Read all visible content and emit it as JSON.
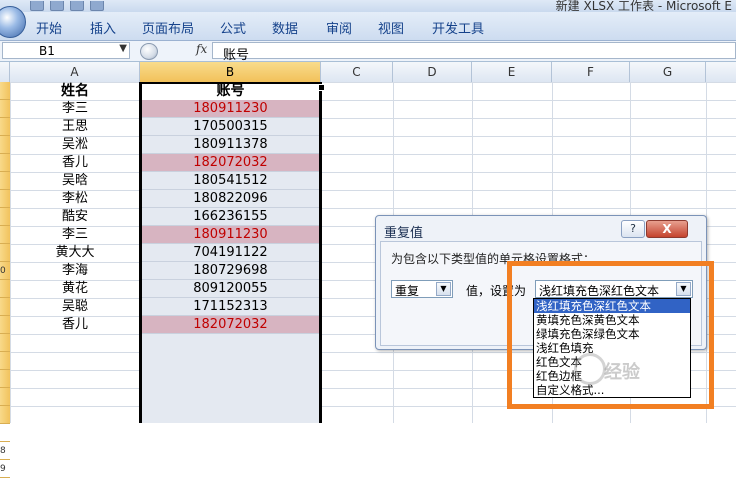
{
  "window": {
    "title": "新建 XLSX 工作表 - Microsoft E"
  },
  "ribbon": {
    "tabs": [
      "开始",
      "插入",
      "页面布局",
      "公式",
      "数据",
      "审阅",
      "视图",
      "开发工具"
    ]
  },
  "formula_bar": {
    "name_box": "B1",
    "fx_label": "fx",
    "content": "账号"
  },
  "columns": [
    "A",
    "B",
    "C",
    "D",
    "E",
    "F",
    "G"
  ],
  "row_numbers": [
    "",
    "",
    "",
    "",
    "",
    "",
    "",
    "",
    "",
    "",
    "0",
    "",
    "",
    "",
    "",
    "",
    "",
    "",
    "",
    "",
    "8",
    "9"
  ],
  "sheet": {
    "header_name": "姓名",
    "header_account": "账号",
    "rows": [
      {
        "name": "李三",
        "account": "180911230",
        "duplicate": true
      },
      {
        "name": "王思",
        "account": "170500315",
        "duplicate": false
      },
      {
        "name": "吴淞",
        "account": "180911378",
        "duplicate": false
      },
      {
        "name": "香儿",
        "account": "182072032",
        "duplicate": true
      },
      {
        "name": "吴晗",
        "account": "180541512",
        "duplicate": false
      },
      {
        "name": "李松",
        "account": "180822096",
        "duplicate": false
      },
      {
        "name": "酷安",
        "account": "166236155",
        "duplicate": false
      },
      {
        "name": "李三",
        "account": "180911230",
        "duplicate": true
      },
      {
        "name": "黄大大",
        "account": "704191122",
        "duplicate": false
      },
      {
        "name": "李海",
        "account": "180729698",
        "duplicate": false
      },
      {
        "name": "黄花",
        "account": "809120055",
        "duplicate": false
      },
      {
        "name": "吴聪",
        "account": "171152313",
        "duplicate": false
      },
      {
        "name": "香儿",
        "account": "182072032",
        "duplicate": true
      }
    ]
  },
  "colors": {
    "duplicate_fill": "#d7b4c1",
    "duplicate_text": "#c00000",
    "highlight_box": "#f27f22",
    "selection": "#3163c5"
  },
  "dialog": {
    "title": "重复值",
    "help": "?",
    "close": "X",
    "prompt": "为包含以下类型值的单元格设置格式：",
    "type_value": "重复",
    "mid_label": "值，设置为",
    "format_value": "浅红填充色深红色文本",
    "options": [
      "浅红填充色深红色文本",
      "黄填充色深黄色文本",
      "绿填充色深绿色文本",
      "浅红色填充",
      "红色文本",
      "红色边框",
      "自定义格式..."
    ],
    "highlighted_index": 0
  },
  "watermark": {
    "text": "经验"
  }
}
